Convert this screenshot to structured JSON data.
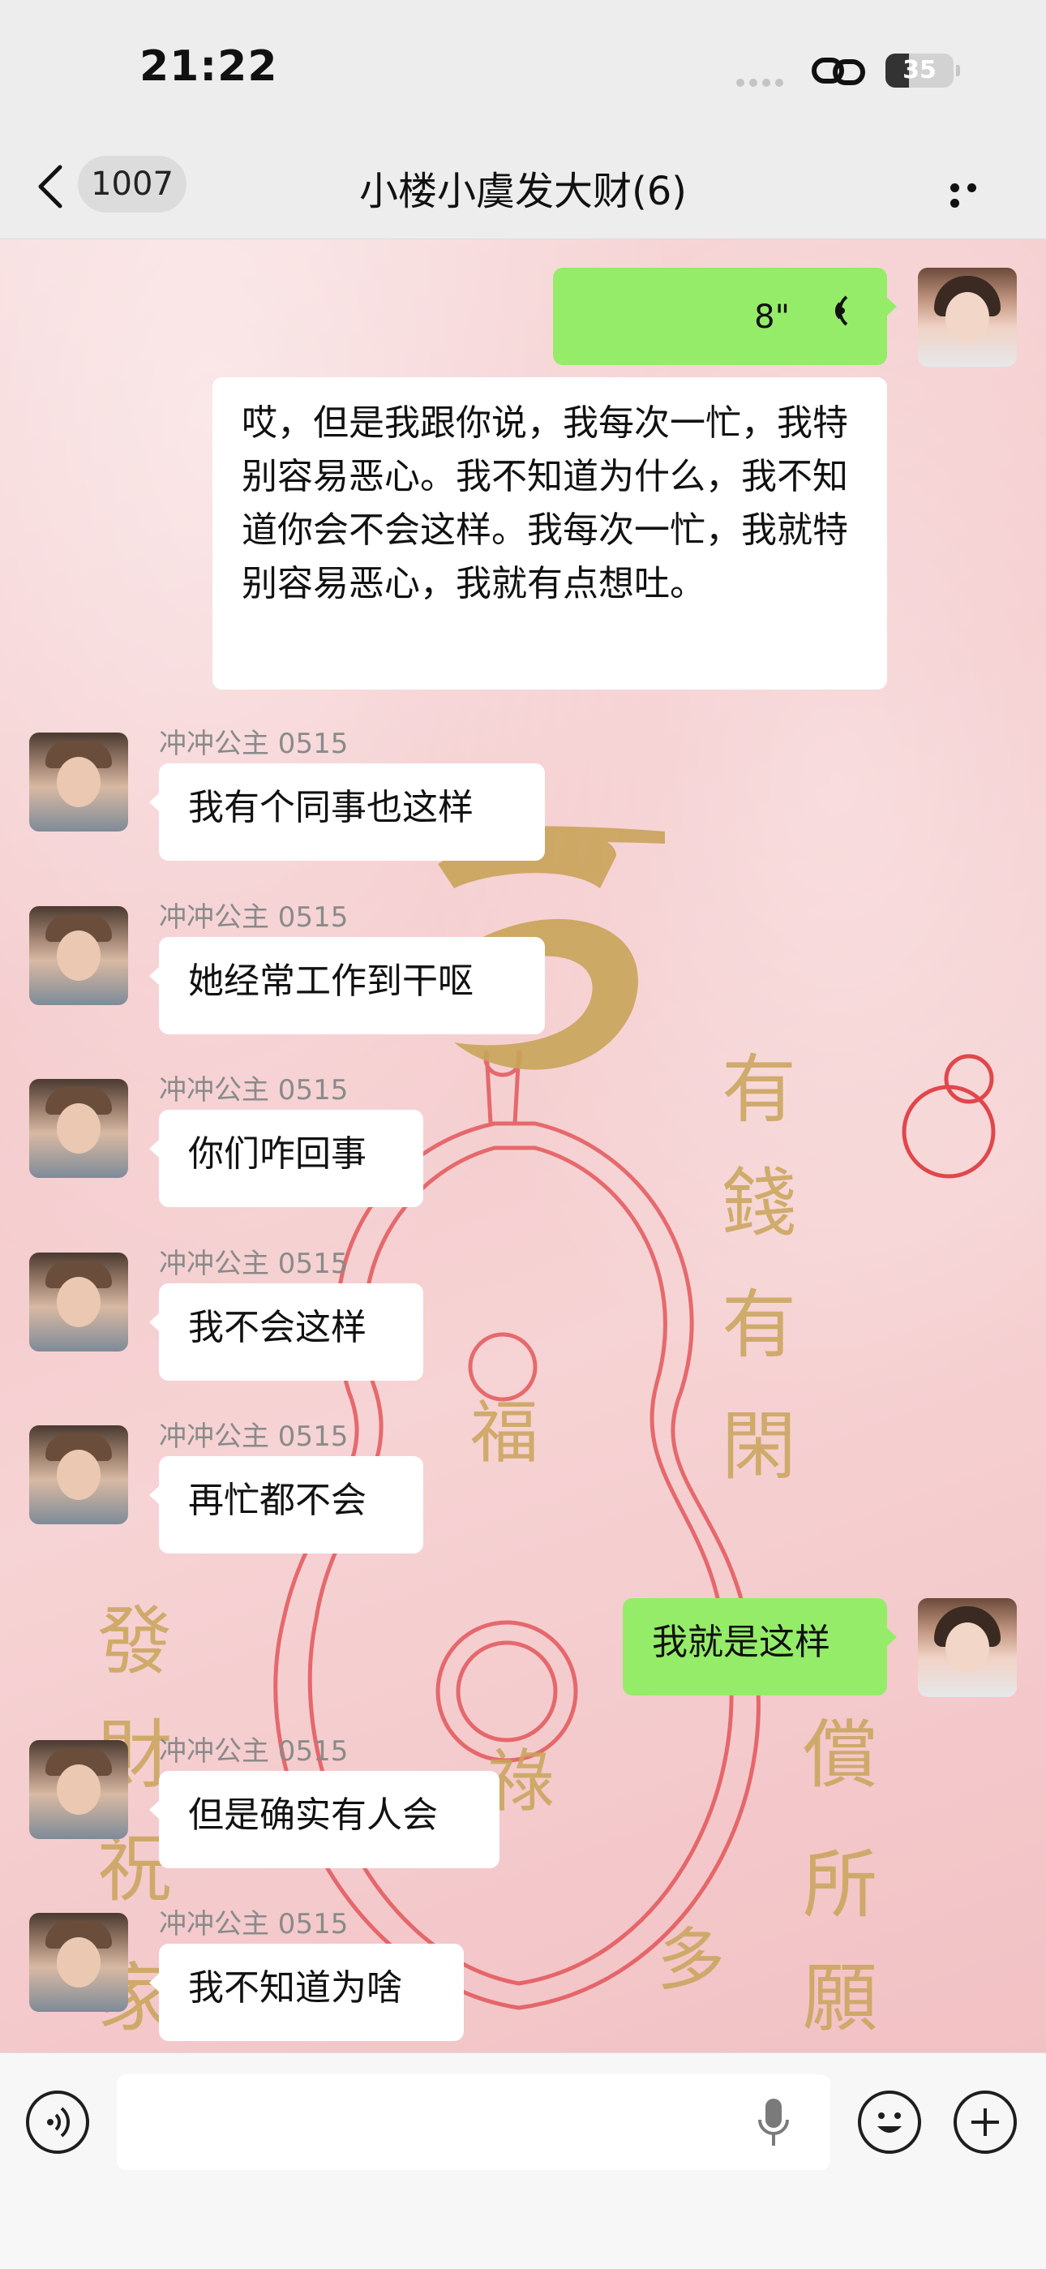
{
  "status_bar": {
    "time": "21:22",
    "battery": "35",
    "battery_level": 0.35
  },
  "header": {
    "back_icon": "chevron-left-icon",
    "unread_count": "1007",
    "title": "小楼小虞发大财(6)",
    "more_icon": "more-dots-icon"
  },
  "messages": [
    {
      "side": "me",
      "type": "voice",
      "duration": "8\""
    },
    {
      "side": "me",
      "type": "text",
      "text": "哎，但是我跟你说，我每次一忙，我特别容易恶心。我不知道为什么，我不知道你会不会这样。我每次一忙，我就特别容易恶心，我就有点想吐。"
    },
    {
      "side": "friend",
      "sender": "冲冲公主 0515",
      "text": "我有个同事也这样"
    },
    {
      "side": "friend",
      "sender": "冲冲公主 0515",
      "text": "她经常工作到干呕"
    },
    {
      "side": "friend",
      "sender": "冲冲公主 0515",
      "text": "你们咋回事"
    },
    {
      "side": "friend",
      "sender": "冲冲公主 0515",
      "text": "我不会这样"
    },
    {
      "side": "friend",
      "sender": "冲冲公主 0515",
      "text": "再忙都不会"
    },
    {
      "side": "me",
      "type": "text",
      "text": "我就是这样"
    },
    {
      "side": "friend",
      "sender": "冲冲公主 0515",
      "text": "但是确实有人会"
    },
    {
      "side": "friend",
      "sender": "冲冲公主 0515",
      "text": "我不知道为啥"
    }
  ],
  "wallpaper": {
    "left_text": "发财祝家",
    "right_text": "有钱有闲得偿所愿",
    "center_text": "福禄",
    "colors": {
      "gold": "#c9a45a",
      "red": "#e0474b",
      "pink": "#f4c9cb"
    }
  },
  "input_bar": {
    "voice_icon": "voice-mode-icon",
    "placeholder": "",
    "mic_icon": "microphone-icon",
    "emoji_icon": "emoji-icon",
    "plus_icon": "plus-icon"
  },
  "colors": {
    "bubble_green": "#95ec69",
    "bubble_white": "#ffffff",
    "header_bg": "#ededed"
  }
}
